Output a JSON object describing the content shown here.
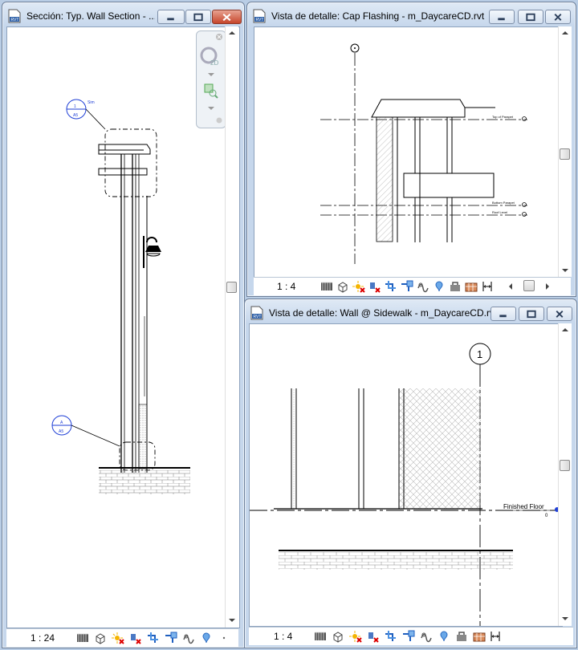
{
  "windows": {
    "section": {
      "title": "Sección: Typ. Wall Section - ...",
      "scale": "1 : 24",
      "tags": [
        {
          "num": "1",
          "sheet": "A5",
          "note": "Sim"
        },
        {
          "num": "A",
          "sheet": "A5"
        }
      ],
      "navbar": {
        "zoom_label": "2D"
      }
    },
    "cap_flashing": {
      "title": "Vista de detalle: Cap Flashing - m_DaycareCD.rvt",
      "scale": "1 : 4",
      "grid_bubble": "",
      "level_labels": [
        "Top of Parapet",
        "Bottom Parapet",
        "Roof Level"
      ]
    },
    "sidewalk": {
      "title": "Vista de detalle: Wall @ Sidewalk - m_DaycareCD.rvt",
      "scale": "1 : 4",
      "grid_bubble": "1",
      "level_label": "Finished Floor",
      "level_value": "0"
    }
  },
  "icons": [
    "revit-file-icon",
    "minimize-icon",
    "restore-icon",
    "close-icon",
    "detail-level-icon",
    "visual-style-icon",
    "sun-path-icon",
    "shadows-icon",
    "crop-view-icon",
    "show-crop-icon",
    "temporary-hide-icon",
    "reveal-hidden-icon",
    "lock-3d-icon",
    "analysis-icon"
  ],
  "colors": {
    "accent": "#1f3fd6",
    "close": "#c6452b",
    "frame": "#b9cde5"
  }
}
